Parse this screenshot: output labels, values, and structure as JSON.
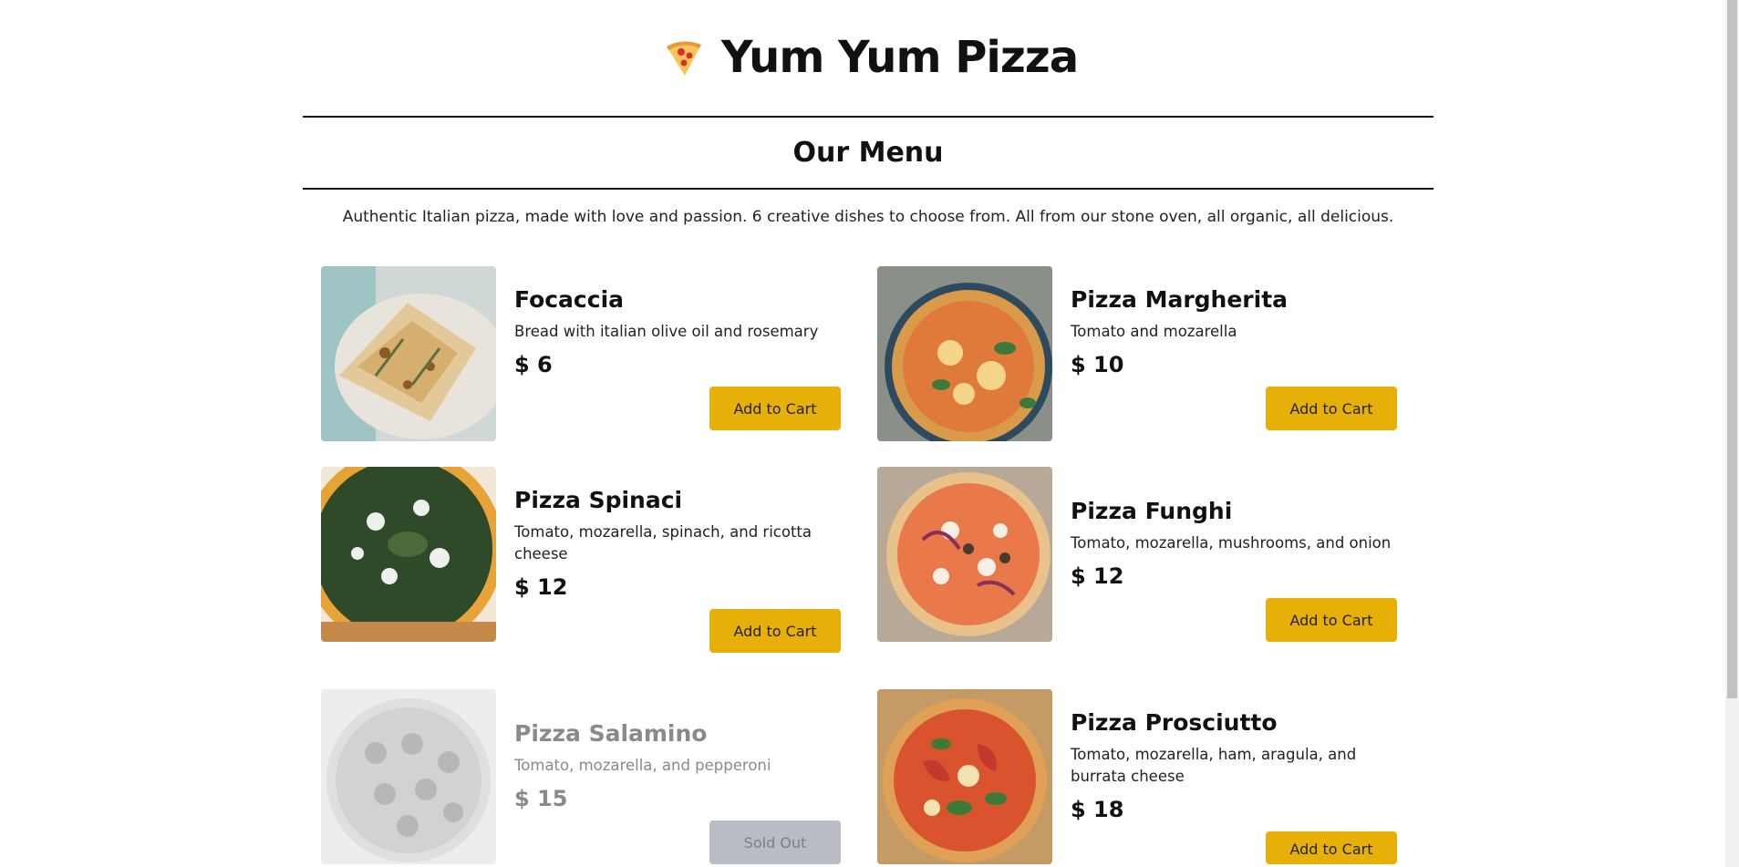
{
  "header": {
    "title": "Yum Yum Pizza",
    "logo_icon": "pizza-slice-icon"
  },
  "menu": {
    "heading": "Our Menu",
    "intro": "Authentic Italian pizza, made with love and passion. 6 creative dishes to choose from. All from our stone oven, all organic, all delicious."
  },
  "colors": {
    "accent": "#e7b008",
    "sold_out_button": "#b9bcc4",
    "text": "#111111"
  },
  "pizzas": [
    {
      "name": "Focaccia",
      "description": "Bread with italian olive oil and rosemary",
      "price": "$ 6",
      "button": "Add to Cart",
      "sold_out": false,
      "image": "focaccia-bread-photo"
    },
    {
      "name": "Pizza Margherita",
      "description": "Tomato and mozarella",
      "price": "$ 10",
      "button": "Add to Cart",
      "sold_out": false,
      "image": "margherita-pizza-photo"
    },
    {
      "name": "Pizza Spinaci",
      "description": "Tomato, mozarella, spinach, and ricotta cheese",
      "price": "$ 12",
      "button": "Add to Cart",
      "sold_out": false,
      "image": "spinach-pizza-photo"
    },
    {
      "name": "Pizza Funghi",
      "description": "Tomato, mozarella, mushrooms, and onion",
      "price": "$ 12",
      "button": "Add to Cart",
      "sold_out": false,
      "image": "funghi-pizza-photo"
    },
    {
      "name": "Pizza Salamino",
      "description": "Tomato, mozarella, and pepperoni",
      "price": "$ 15",
      "button": "Sold Out",
      "sold_out": true,
      "image": "salamino-pizza-photo"
    },
    {
      "name": "Pizza Prosciutto",
      "description": "Tomato, mozarella, ham, aragula, and burrata cheese",
      "price": "$ 18",
      "button": "Add to Cart",
      "sold_out": false,
      "image": "prosciutto-pizza-photo"
    }
  ]
}
